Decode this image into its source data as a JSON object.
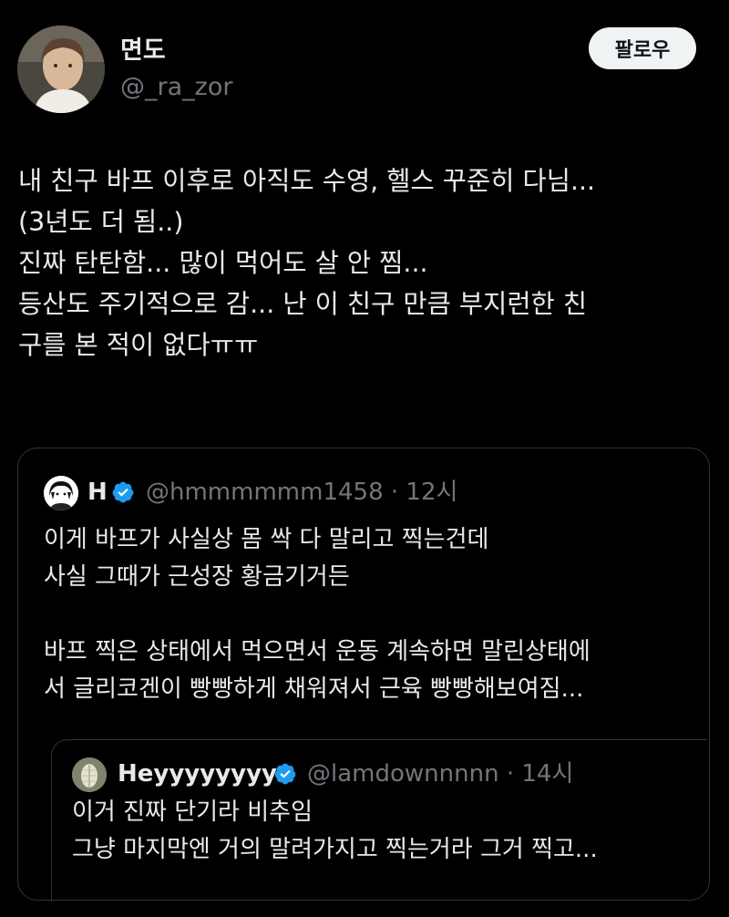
{
  "author": {
    "name": "면도",
    "handle": "@_ra_zor",
    "follow_label": "팔로우"
  },
  "tweet": {
    "lines": [
      "내 친구 바프 이후로 아직도 수영, 헬스 꾸준히 다님...",
      "(3년도 더 됨..)",
      "진짜 탄탄함... 많이 먹어도 살 안 찜...",
      "등산도 주기적으로 감... 난 이 친구 만큼 부지런한 친",
      "구를 본 적이 없다ㅠㅠ"
    ]
  },
  "quote": {
    "name": "H",
    "handle": "@hmmmmmm1458",
    "time": "12시",
    "lines": [
      "이게 바프가 사실상 몸 싹 다 말리고 찍는건데",
      "사실 그때가 근성장 황금기거든",
      "",
      "바프 찍은 상태에서 먹으면서 운동 계속하면 말린상태에",
      "서 글리코겐이 빵빵하게 채워져서 근육 빵빵해보여짐..."
    ],
    "inner": {
      "name": "Heyyyyyyyy",
      "handle": "@lamdownnnnn",
      "time": "14시",
      "lines": [
        "이거 진짜 단기라 비추임",
        "그냥 마지막엔 거의 말려가지고 찍는거라 그거 찍고..."
      ]
    }
  },
  "colors": {
    "background": "#000000",
    "text": "#e7e9ea",
    "secondary": "#71767b",
    "border": "#2f3336",
    "verified": "#1d9bf0"
  }
}
